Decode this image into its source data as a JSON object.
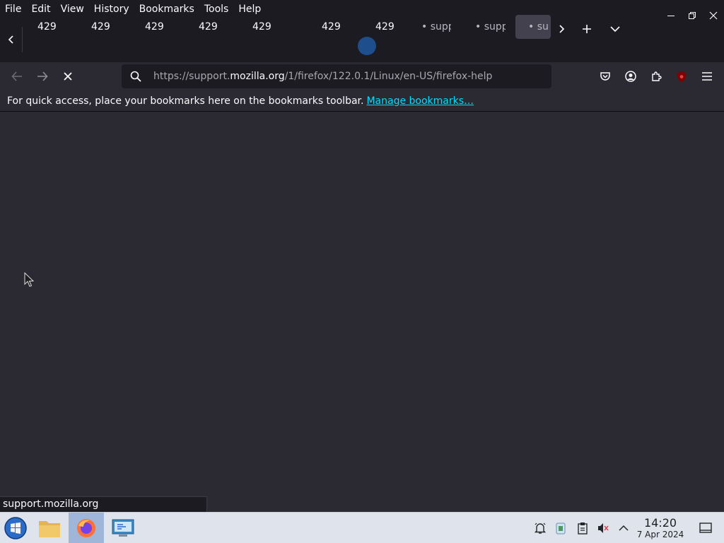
{
  "menubar": {
    "items": [
      "File",
      "Edit",
      "View",
      "History",
      "Bookmarks",
      "Tools",
      "Help"
    ]
  },
  "tabs": [
    {
      "label": "429"
    },
    {
      "label": "429"
    },
    {
      "label": "429"
    },
    {
      "label": "429"
    },
    {
      "label": "429"
    },
    {
      "label": "429"
    },
    {
      "label": "429"
    },
    {
      "label": "• supp"
    },
    {
      "label": "• supp"
    },
    {
      "label": "• su"
    }
  ],
  "navbar": {
    "url_scheme": "https://support.",
    "url_host": "mozilla.org",
    "url_path": "/1/firefox/122.0.1/Linux/en-US/firefox-help"
  },
  "bookmarks_bar": {
    "message": "For quick access, place your bookmarks here on the bookmarks toolbar.",
    "manage_link": "Manage bookmarks…"
  },
  "status": {
    "text": "support.mozilla.org"
  },
  "taskbar": {
    "time": "14:20",
    "date": "7 Apr 2024"
  },
  "colors": {
    "chrome_bg": "#1c1b22",
    "content_bg": "#2b2a33",
    "link": "#00ddff",
    "taskbar_bg": "#dfe4ec"
  }
}
